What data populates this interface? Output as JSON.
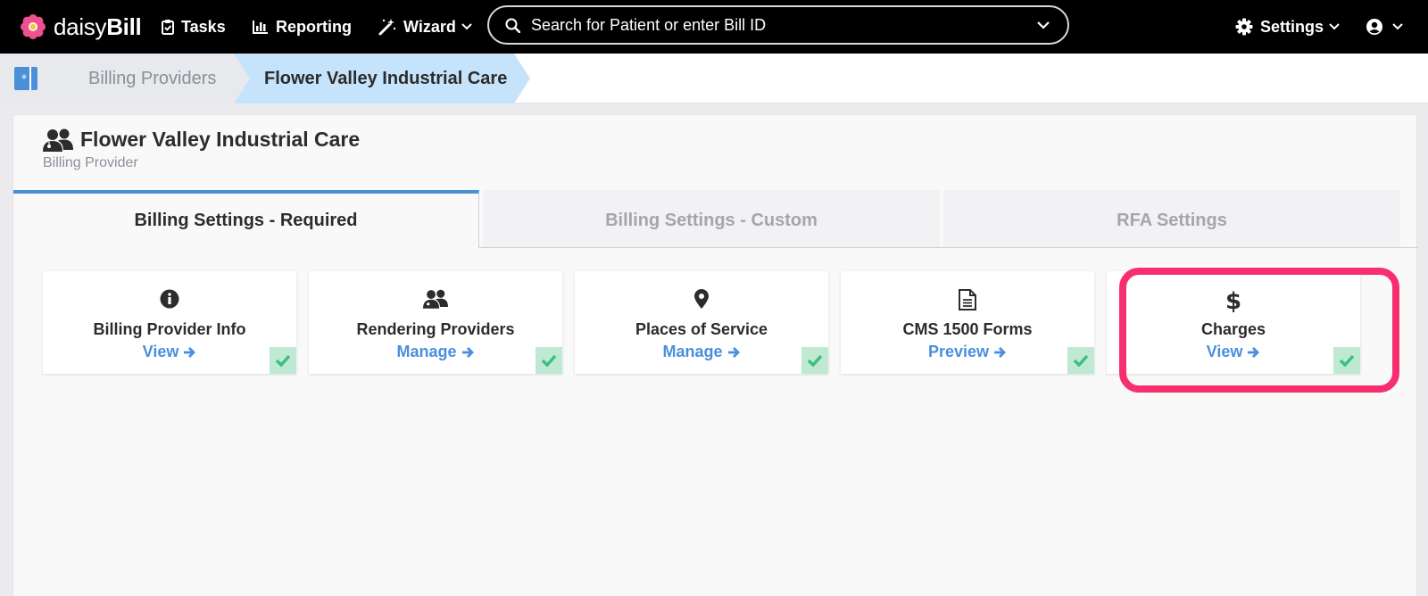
{
  "topbar": {
    "brand_light": "daisy",
    "brand_bold": "Bill",
    "tasks_label": "Tasks",
    "reporting_label": "Reporting",
    "wizard_label": "Wizard",
    "search_placeholder": "Search for Patient or enter Bill ID",
    "settings_label": "Settings"
  },
  "breadcrumb": {
    "items": [
      {
        "label": "Billing Providers"
      },
      {
        "label": "Flower Valley Industrial Care"
      }
    ]
  },
  "page": {
    "title": "Flower Valley Industrial Care",
    "subtitle": "Billing Provider"
  },
  "tabs": [
    {
      "label": "Billing Settings - Required",
      "active": true
    },
    {
      "label": "Billing Settings - Custom",
      "active": false
    },
    {
      "label": "RFA Settings",
      "active": false
    }
  ],
  "cards": [
    {
      "icon": "info-circle-icon",
      "label": "Billing Provider Info",
      "link": "View",
      "complete": true
    },
    {
      "icon": "user-group-icon",
      "label": "Rendering Providers",
      "link": "Manage",
      "complete": true
    },
    {
      "icon": "map-pin-icon",
      "label": "Places of Service",
      "link": "Manage",
      "complete": true
    },
    {
      "icon": "document-icon",
      "label": "CMS 1500 Forms",
      "link": "Preview",
      "complete": true
    },
    {
      "icon": "dollar-icon",
      "label": "Charges",
      "link": "View",
      "complete": true
    }
  ],
  "colors": {
    "accent": "#4a8fde",
    "highlight": "#f72f6f",
    "check_bg": "#bfe9d3",
    "check": "#3dbf7f"
  }
}
